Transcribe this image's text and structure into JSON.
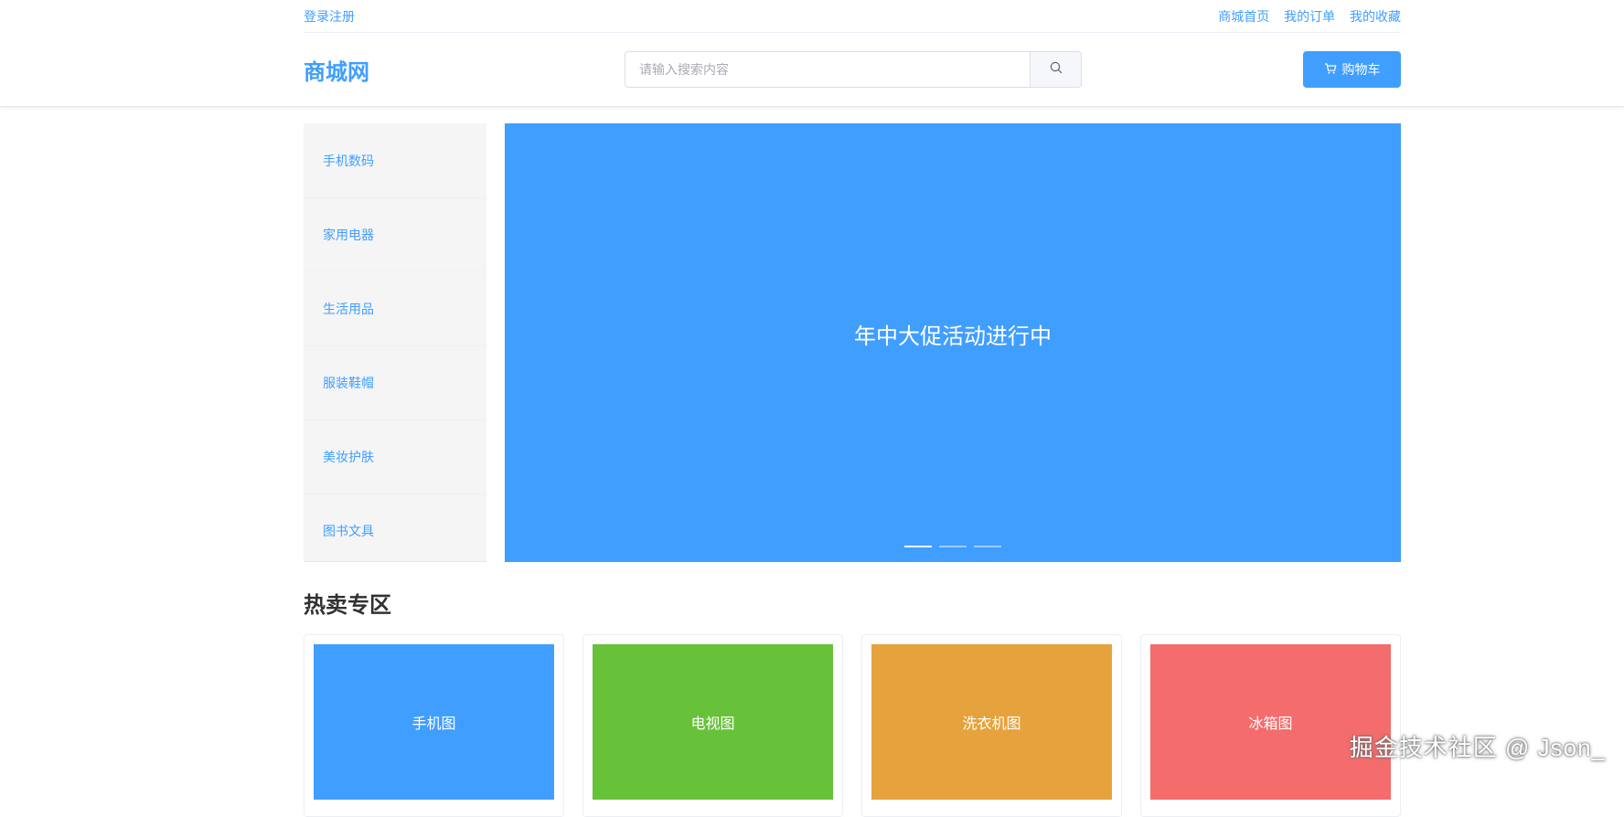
{
  "topbar": {
    "login_register": "登录注册",
    "links": [
      "商城首页",
      "我的订单",
      "我的收藏"
    ]
  },
  "header": {
    "logo": "商城网",
    "search_placeholder": "请输入搜索内容",
    "search_icon": "search-icon",
    "cart_icon": "cart-icon",
    "cart_label": "购物车"
  },
  "categories": [
    "手机数码",
    "家用电器",
    "生活用品",
    "服装鞋帽",
    "美妆护肤",
    "图书文具"
  ],
  "banner": {
    "text": "年中大促活动进行中",
    "color": "#409eff",
    "slide_count": 3,
    "active_slide": 1
  },
  "hot": {
    "title": "热卖专区",
    "products": [
      {
        "label": "手机图",
        "color": "#409eff"
      },
      {
        "label": "电视图",
        "color": "#67c23a"
      },
      {
        "label": "洗衣机图",
        "color": "#e6a23c"
      },
      {
        "label": "冰箱图",
        "color": "#f56c6c"
      }
    ]
  },
  "watermark": "掘金技术社区 @ Json_",
  "colors": {
    "accent": "#409eff"
  }
}
